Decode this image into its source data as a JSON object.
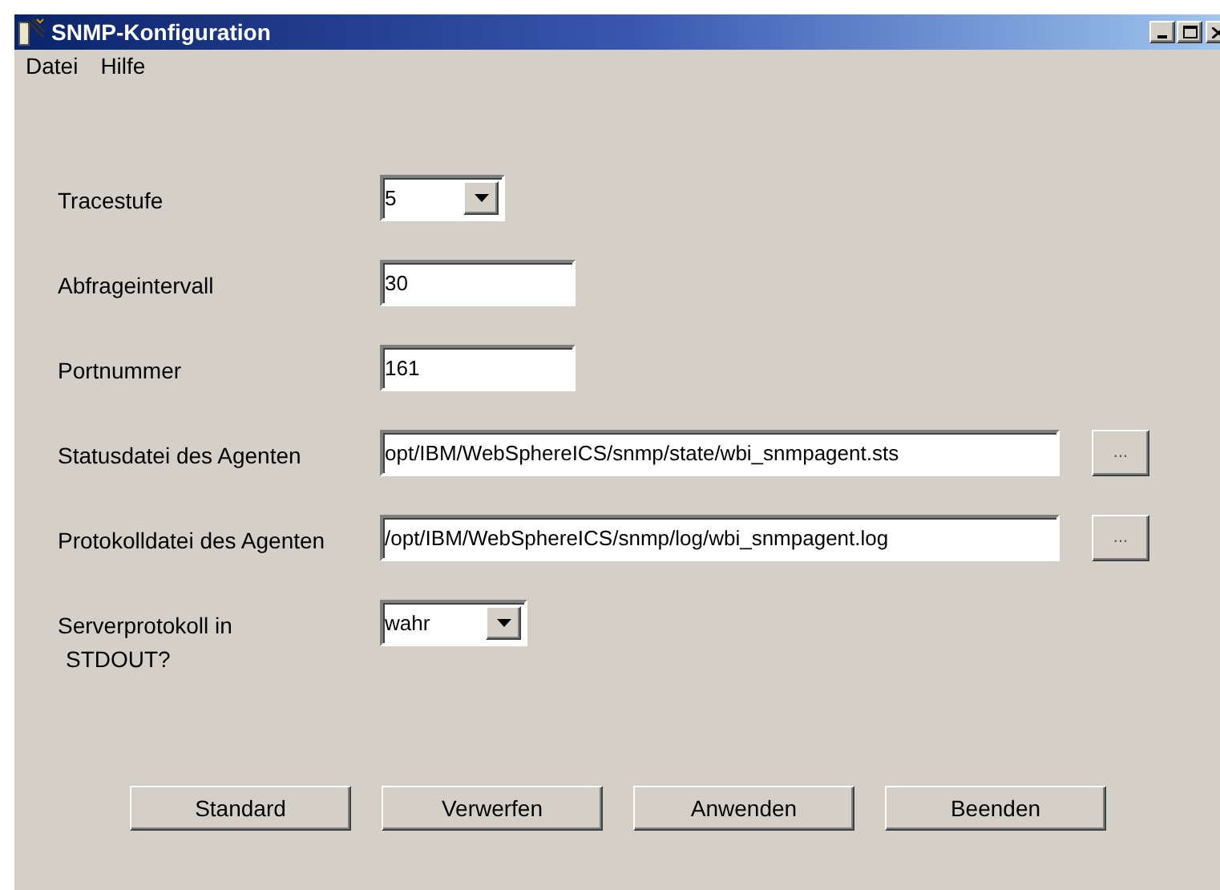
{
  "window": {
    "title": "SNMP-Konfiguration"
  },
  "menu": [
    "Datei",
    "Hilfe"
  ],
  "fields": [
    {
      "label": "Tracestufe",
      "kind": "combo",
      "value": "5"
    },
    {
      "label": "Abfrageintervall",
      "kind": "text",
      "value": "30"
    },
    {
      "label": "Portnummer",
      "kind": "text",
      "value": "161"
    },
    {
      "label": "Statusdatei des Agenten",
      "kind": "file",
      "value": "opt/IBM/WebSphereICS/snmp/state/wbi_snmpagent.sts",
      "browse": "..."
    },
    {
      "label": "Protokolldatei des Agenten",
      "kind": "file",
      "value": "/opt/IBM/WebSphereICS/snmp/log/wbi_snmpagent.log",
      "browse": "..."
    },
    {
      "label": "Serverprotokoll in",
      "label_2": "STDOUT?",
      "kind": "combo",
      "value": "wahr"
    }
  ],
  "buttons": [
    "Standard",
    "Verwerfen",
    "Anwenden",
    "Beenden"
  ]
}
